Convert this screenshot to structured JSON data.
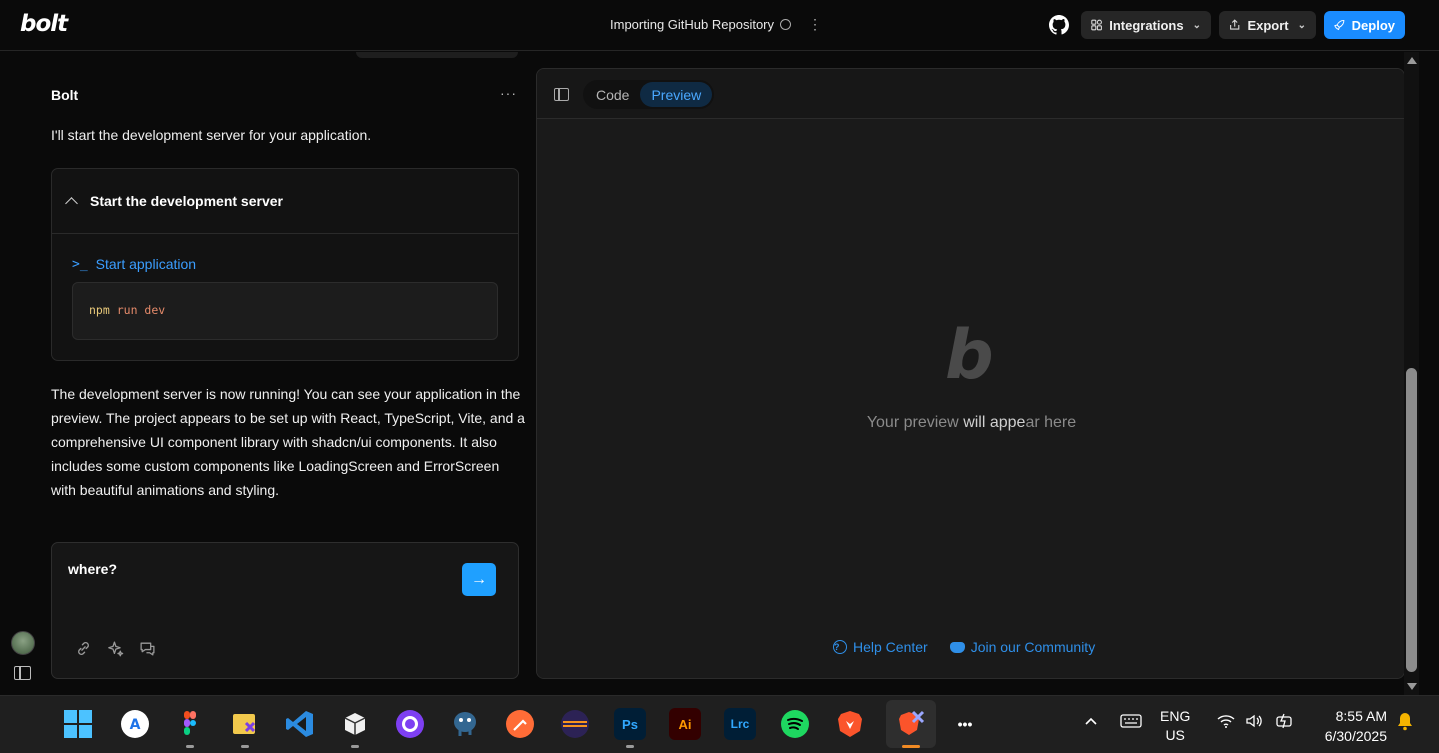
{
  "header": {
    "logo": "bolt",
    "project_title": "Importing GitHub Repository",
    "more_label": "⋮",
    "integrations_label": "Integrations",
    "export_label": "Export",
    "deploy_label": "Deploy"
  },
  "chat": {
    "author": "Bolt",
    "more_label": "···",
    "intro": "I'll start the development server for your application.",
    "action": {
      "title": "Start the development server",
      "step_label": "Start application",
      "command": "npm",
      "command_args": "run dev"
    },
    "summary": "The development server is now running! You can see your application in the preview. The project appears to be set up with React, TypeScript, Vite, and a comprehensive UI component library with shadcn/ui components. It also includes some custom components like LoadingScreen and ErrorScreen with beautiful animations and styling.",
    "input_value": "where?"
  },
  "workbench": {
    "tabs": [
      {
        "label": "Code",
        "active": false
      },
      {
        "label": "Preview",
        "active": true
      }
    ],
    "preview_logo": "b",
    "preview_msg_part1": "Your preview ",
    "preview_msg_part2": "will appe",
    "preview_msg_part3": "ar here",
    "help_center": "Help Center",
    "community": "Join our Community"
  },
  "taskbar": {
    "apps": [
      {
        "name": "windows-start",
        "label": ""
      },
      {
        "name": "app-store",
        "label": "A"
      },
      {
        "name": "figma",
        "label": ""
      },
      {
        "name": "file-manager",
        "label": ""
      },
      {
        "name": "vscode",
        "label": ""
      },
      {
        "name": "terminal-box",
        "label": ""
      },
      {
        "name": "github-desktop",
        "label": ""
      },
      {
        "name": "postgresql",
        "label": ""
      },
      {
        "name": "postman",
        "label": ""
      },
      {
        "name": "eclipse",
        "label": ""
      },
      {
        "name": "photoshop",
        "label": "Ps"
      },
      {
        "name": "illustrator",
        "label": "Ai"
      },
      {
        "name": "lightroom",
        "label": "Lrc"
      },
      {
        "name": "spotify",
        "label": ""
      },
      {
        "name": "brave",
        "label": ""
      },
      {
        "name": "brave-active",
        "label": ""
      },
      {
        "name": "more-apps",
        "label": "•••"
      }
    ],
    "lang_line1": "ENG",
    "lang_line2": "US",
    "time": "8:55 AM",
    "date": "6/30/2025"
  },
  "colors": {
    "accent": "#1a8cff",
    "link": "#2f8fe8",
    "background": "#0a0a0a"
  }
}
